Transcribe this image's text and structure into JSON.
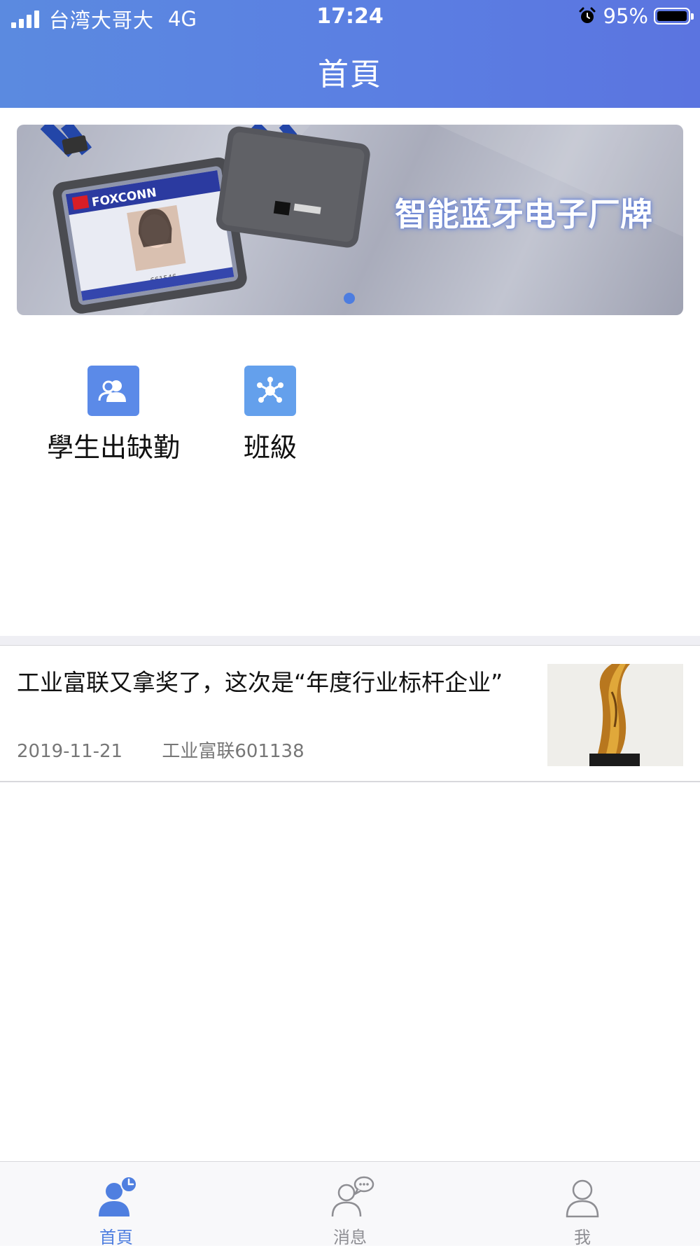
{
  "status_bar": {
    "carrier": "台湾大哥大",
    "network": "4G",
    "time": "17:24",
    "battery": "95%"
  },
  "header": {
    "title": "首頁"
  },
  "banner": {
    "caption": "智能蓝牙电子厂牌",
    "badge_logo": "FOXCONN",
    "badge_id": "661546",
    "active_slide": 1,
    "slide_count": 1
  },
  "shortcuts": [
    {
      "label": "學生出缺勤",
      "icon": "users-icon",
      "color": "#5b8ae8"
    },
    {
      "label": "班級",
      "icon": "network-icon",
      "color": "#64a0ec"
    }
  ],
  "news": [
    {
      "title": "工业富联又拿奖了，这次是“年度行业标杆企业”",
      "date": "2019-11-21",
      "source": "工业富联601138",
      "thumbnail": "trophy-image"
    }
  ],
  "tabbar": {
    "active_color": "#4f7fe0",
    "inactive_color": "#8e8e93",
    "items": [
      {
        "label": "首頁",
        "icon": "home-person-clock-icon",
        "active": true
      },
      {
        "label": "消息",
        "icon": "person-chat-icon",
        "active": false
      },
      {
        "label": "我",
        "icon": "person-icon",
        "active": false
      }
    ]
  }
}
